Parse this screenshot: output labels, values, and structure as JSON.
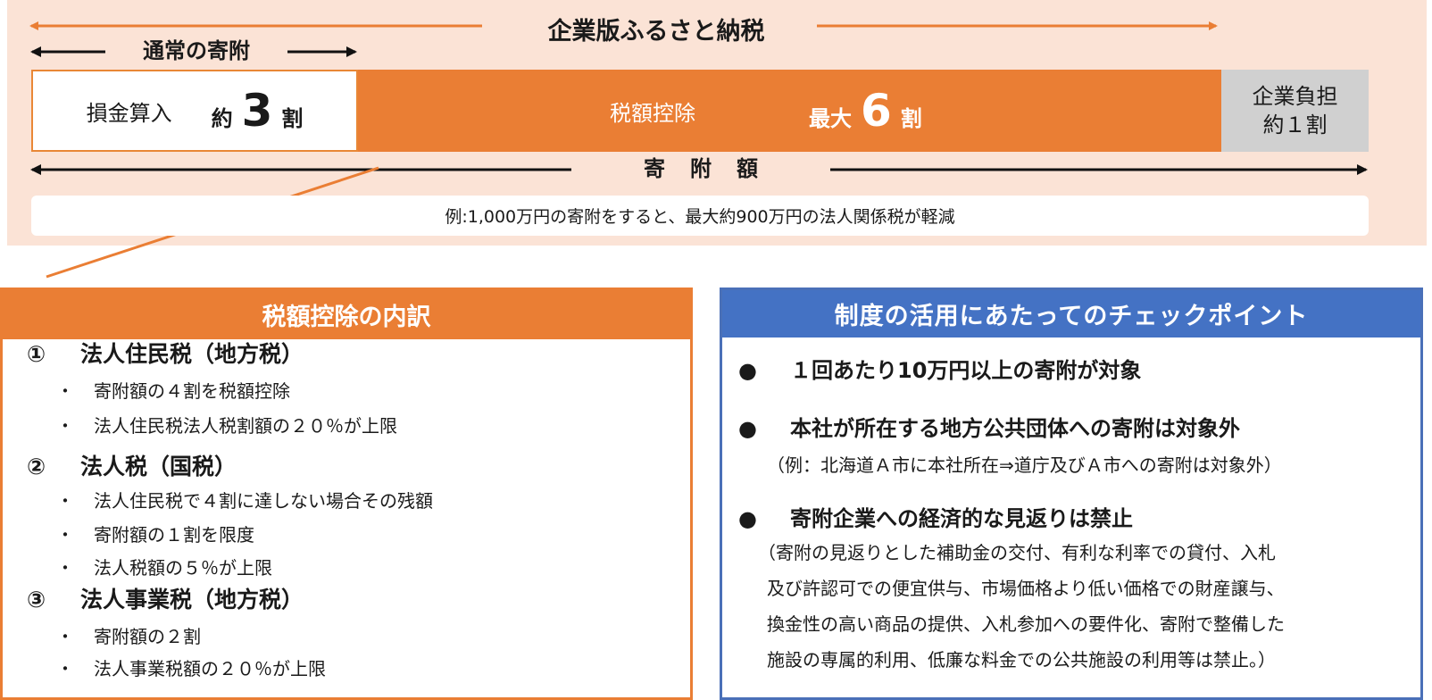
{
  "top": {
    "title": "企業版ふるさと納税",
    "normal_donation_label": "通常の寄附",
    "donation_amount_label": "寄附額",
    "deduction": {
      "label": "損金算入",
      "prefix": "約",
      "value": "3",
      "suffix": "割"
    },
    "tax_credit": {
      "label": "税額控除",
      "prefix": "最大",
      "value": "6",
      "suffix": "割"
    },
    "burden": {
      "line1": "企業負担",
      "line2": "約１割"
    },
    "example": "例:1,000万円の寄附をすると、最大約900万円の法人関係税が軽減"
  },
  "breakdown": {
    "title": "税額控除の内訳",
    "sections": [
      {
        "num": "①",
        "title": "法人住民税（地方税）",
        "items": [
          "寄附額の４割を税額控除",
          "法人住民税法人税割額の２０％が上限"
        ]
      },
      {
        "num": "②",
        "title": "法人税（国税）",
        "items": [
          "法人住民税で４割に達しない場合その残額",
          "寄附額の１割を限度",
          "法人税額の５％が上限"
        ]
      },
      {
        "num": "③",
        "title": "法人事業税（地方税）",
        "items": [
          "寄附額の２割",
          "法人事業税額の２０％が上限"
        ]
      }
    ],
    "bullet": "・"
  },
  "checkpoints": {
    "title": "制度の活用にあたってのチェックポイント",
    "bullet": "●",
    "items": [
      {
        "text": "１回あたり10万円以上の寄附が対象"
      },
      {
        "text": "本社が所在する地方公共団体への寄附は対象外",
        "note": "（例：北海道Ａ市に本社所在⇒道庁及びＡ市への寄附は対象外）"
      },
      {
        "text": "寄附企業への経済的な見返りは禁止",
        "note_lines": [
          "（寄附の見返りとした補助金の交付、有利な利率での貸付、入札",
          "及び許認可での便宜供与、市場価格より低い価格での財産譲与、",
          "換金性の高い商品の提供、入札参加への要件化、寄附で整備した",
          "施設の専属的利用、低廉な料金での公共施設の利用等は禁止。）"
        ]
      }
    ]
  },
  "colors": {
    "orange": "#ea7e34",
    "blue": "#4472c4",
    "peach": "#fbe3d6",
    "gray": "#d0d0d0"
  }
}
